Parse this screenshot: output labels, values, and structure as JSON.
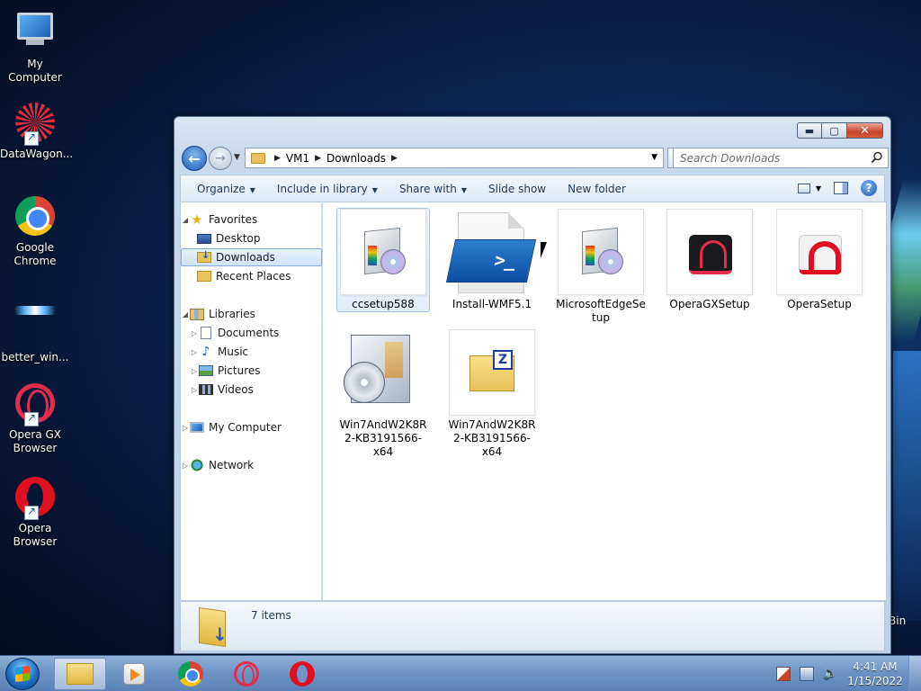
{
  "desktop": {
    "icons": [
      {
        "label": "My Computer",
        "icon": "computer-icon"
      },
      {
        "label": "DataWagon...",
        "icon": "datawagon-icon"
      },
      {
        "label": "Google Chrome",
        "icon": "chrome-icon"
      },
      {
        "label": "better_win...",
        "icon": "app-icon"
      },
      {
        "label": "Opera GX Browser",
        "icon": "opera-gx-icon"
      },
      {
        "label": "Opera Browser",
        "icon": "opera-icon"
      }
    ],
    "recycle_bin_partial": "Bin"
  },
  "window": {
    "caption_buttons": {
      "minimize": "▬",
      "maximize": "▢",
      "close": "✕"
    },
    "nav": {
      "back": "←",
      "forward": "→"
    },
    "address": {
      "crumbs": [
        "VM1",
        "Downloads"
      ]
    },
    "search": {
      "placeholder": "Search Downloads"
    },
    "command_bar": {
      "organize": "Organize",
      "include_in_library": "Include in library",
      "share_with": "Share with",
      "slide_show": "Slide show",
      "new_folder": "New folder"
    },
    "nav_pane": {
      "favorites": "Favorites",
      "desktop": "Desktop",
      "downloads": "Downloads",
      "recent_places": "Recent Places",
      "libraries": "Libraries",
      "documents": "Documents",
      "music": "Music",
      "pictures": "Pictures",
      "videos": "Videos",
      "my_computer": "My Computer",
      "network": "Network"
    },
    "files": [
      {
        "name": "ccsetup588",
        "selected": true
      },
      {
        "name": "Install-WMF5.1"
      },
      {
        "name": "MicrosoftEdgeSetup"
      },
      {
        "name": "OperaGXSetup"
      },
      {
        "name": "OperaSetup"
      },
      {
        "name": "Win7AndW2K8R2-KB3191566-x64"
      },
      {
        "name": "Win7AndW2K8R2-KB3191566-x64"
      }
    ],
    "status": {
      "item_count": "7 items"
    }
  },
  "taskbar": {
    "clock": {
      "time": "4:41 AM",
      "date": "1/15/2022"
    }
  }
}
